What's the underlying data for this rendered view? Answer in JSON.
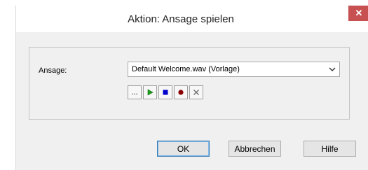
{
  "window": {
    "title": "Aktion: Ansage spielen",
    "close_glyph": "✕"
  },
  "form": {
    "ansage_label": "Ansage:",
    "ansage_value": "Default Welcome.wav (Vorlage)"
  },
  "toolbar": {
    "browse_label": "...",
    "icons": [
      "browse-icon",
      "play-icon",
      "stop-icon",
      "record-icon",
      "delete-icon"
    ],
    "colors": {
      "play": "#1aa01a",
      "stop": "#0000cc",
      "record": "#8b0000",
      "delete": "#6a6a6a"
    }
  },
  "buttons": {
    "ok": "OK",
    "cancel": "Abbrechen",
    "help": "Hilfe"
  }
}
